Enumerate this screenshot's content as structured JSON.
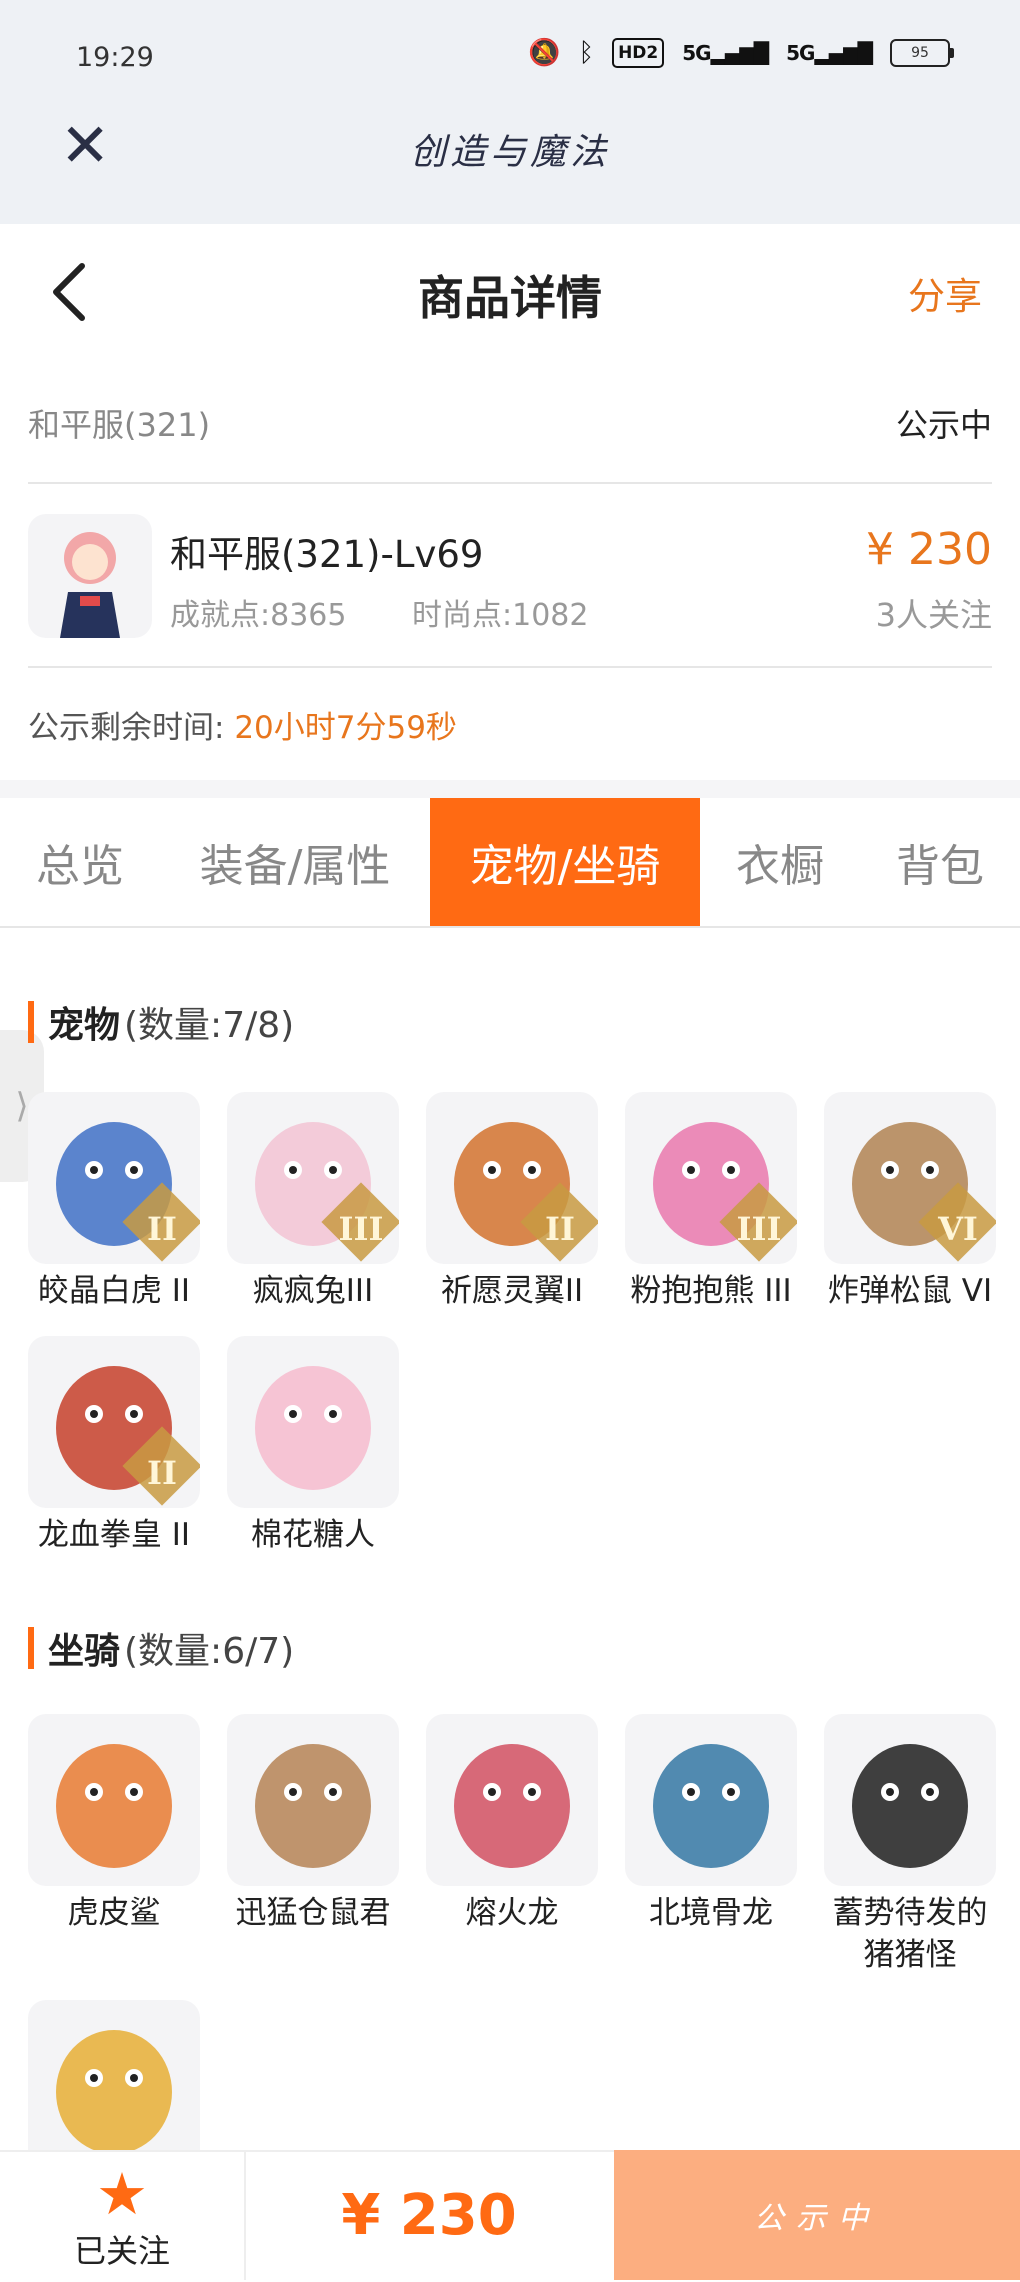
{
  "status_bar": {
    "time": "19:29",
    "battery": "95",
    "hd_label": "HD2",
    "signal_label": "5G"
  },
  "app_bar": {
    "title": "创造与魔法"
  },
  "nav": {
    "title": "商品详情",
    "share": "分享"
  },
  "listing": {
    "server": "和平服(321)",
    "status": "公示中",
    "character_name": "和平服(321)-Lv69",
    "achievement": "成就点:8365",
    "fashion": "时尚点:1082",
    "price": "¥ 230",
    "followers": "3人关注",
    "timer_label": "公示剩余时间:",
    "timer_value": "20小时7分59秒"
  },
  "tabs": [
    "总览",
    "装备/属性",
    "宠物/坐骑",
    "衣橱",
    "背包"
  ],
  "active_tab": "宠物/坐骑",
  "pets": {
    "title": "宠物",
    "count": "(数量:7/8)",
    "items": [
      {
        "name": "皎晶白虎 II",
        "rank": "II",
        "icon": "tiger-icon",
        "color": "#4a78c9"
      },
      {
        "name": "疯疯兔III",
        "rank": "III",
        "icon": "rabbit-icon",
        "color": "#f3c6d6"
      },
      {
        "name": "祈愿灵翼II",
        "rank": "II",
        "icon": "eagle-icon",
        "color": "#d57a3a"
      },
      {
        "name": "粉抱抱熊 III",
        "rank": "III",
        "icon": "bear-icon",
        "color": "#ea7fb1"
      },
      {
        "name": "炸弹松鼠 VI",
        "rank": "VI",
        "icon": "squirrel-icon",
        "color": "#b58a5c"
      },
      {
        "name": "龙血拳皇 II",
        "rank": "II",
        "icon": "dragon-boxer-icon",
        "color": "#c94a36"
      },
      {
        "name": "棉花糖人",
        "rank": "",
        "icon": "marshmallow-icon",
        "color": "#f6bfd0"
      }
    ]
  },
  "mounts": {
    "title": "坐骑",
    "count": "(数量:6/7)",
    "items": [
      {
        "name": "虎皮鲨",
        "icon": "shark-icon",
        "color": "#e9823d"
      },
      {
        "name": "迅猛仓鼠君",
        "icon": "hamster-icon",
        "color": "#b98a5e"
      },
      {
        "name": "熔火龙",
        "icon": "fire-dragon-icon",
        "color": "#d45a6a"
      },
      {
        "name": "北境骨龙",
        "icon": "bone-dragon-icon",
        "color": "#3f7ea8"
      },
      {
        "name": "蓄势待发的猪猪怪",
        "icon": "pig-icon",
        "color": "#2b2b2b"
      },
      {
        "name": "",
        "icon": "parrot-icon",
        "color": "#e8b340"
      }
    ]
  },
  "bottom": {
    "follow_label": "已关注",
    "price": "¥ 230",
    "action": "公示中"
  }
}
